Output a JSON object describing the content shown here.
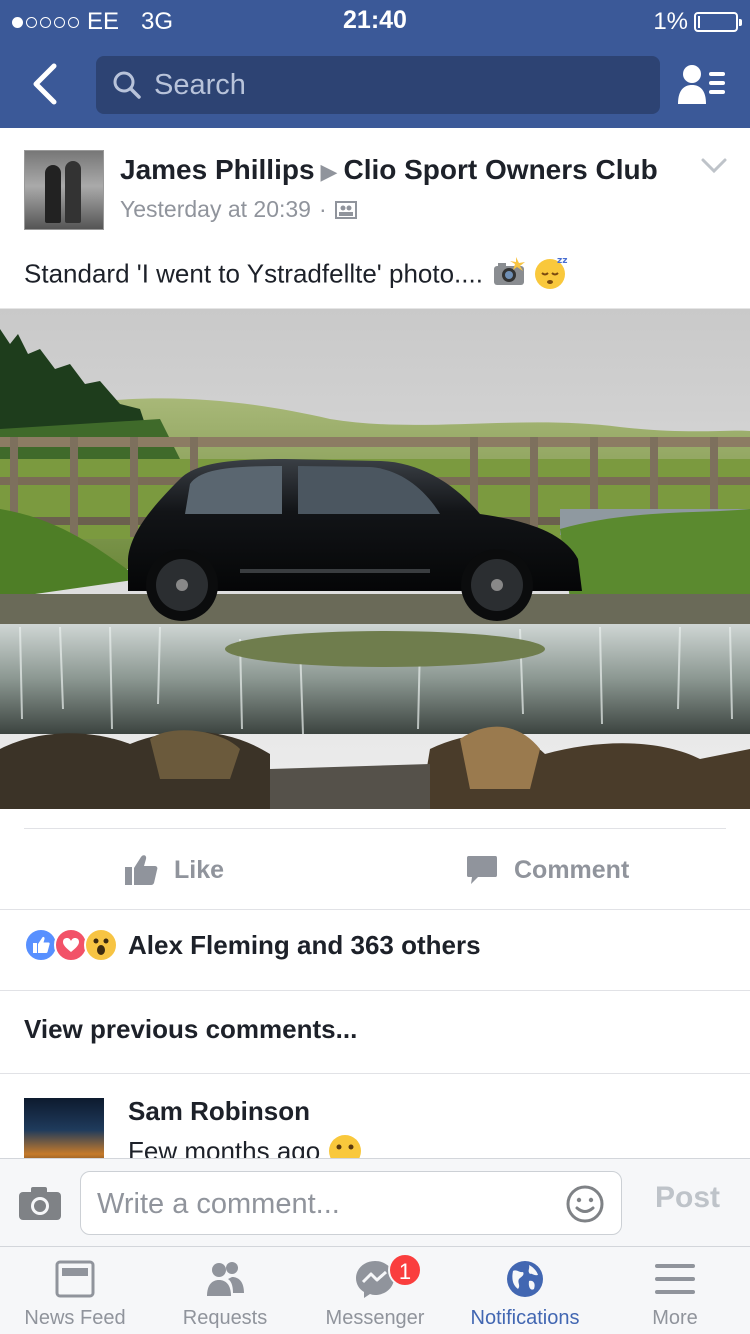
{
  "status_bar": {
    "carrier": "EE",
    "network": "3G",
    "time": "21:40",
    "battery": "1%"
  },
  "nav": {
    "search_placeholder": "Search",
    "back_icon": "chevron-left-icon",
    "friends_icon": "friend-requests-icon"
  },
  "post": {
    "author": "James Phillips",
    "group": "Clio Sport Owners Club",
    "timestamp": "Yesterday at 20:39",
    "text": "Standard 'I went to Ystradfellte' photo....",
    "photo_subject": "black hatchback parked at a river weir with a wooden bridge and green hills behind"
  },
  "actions": {
    "like": "Like",
    "comment": "Comment"
  },
  "reactions": {
    "names": "Alex Fleming and 363 others",
    "types": [
      "like",
      "love",
      "wow"
    ]
  },
  "comments": {
    "view_previous": "View previous comments...",
    "items": [
      {
        "name": "Sam Robinson",
        "text": "Few months ago"
      }
    ]
  },
  "composer": {
    "placeholder": "Write a comment...",
    "post_label": "Post"
  },
  "tabs": [
    {
      "label": "News Feed",
      "icon": "news-feed-icon",
      "active": false
    },
    {
      "label": "Requests",
      "icon": "requests-icon",
      "active": false
    },
    {
      "label": "Messenger",
      "icon": "messenger-icon",
      "active": false,
      "badge": "1"
    },
    {
      "label": "Notifications",
      "icon": "globe-icon",
      "active": true
    },
    {
      "label": "More",
      "icon": "menu-icon",
      "active": false
    }
  ],
  "colors": {
    "brand_blue": "#3b5998",
    "search_bg": "#2d4373",
    "active_tab": "#4267b2",
    "muted": "#90949c",
    "badge_red": "#fa3e3e"
  }
}
